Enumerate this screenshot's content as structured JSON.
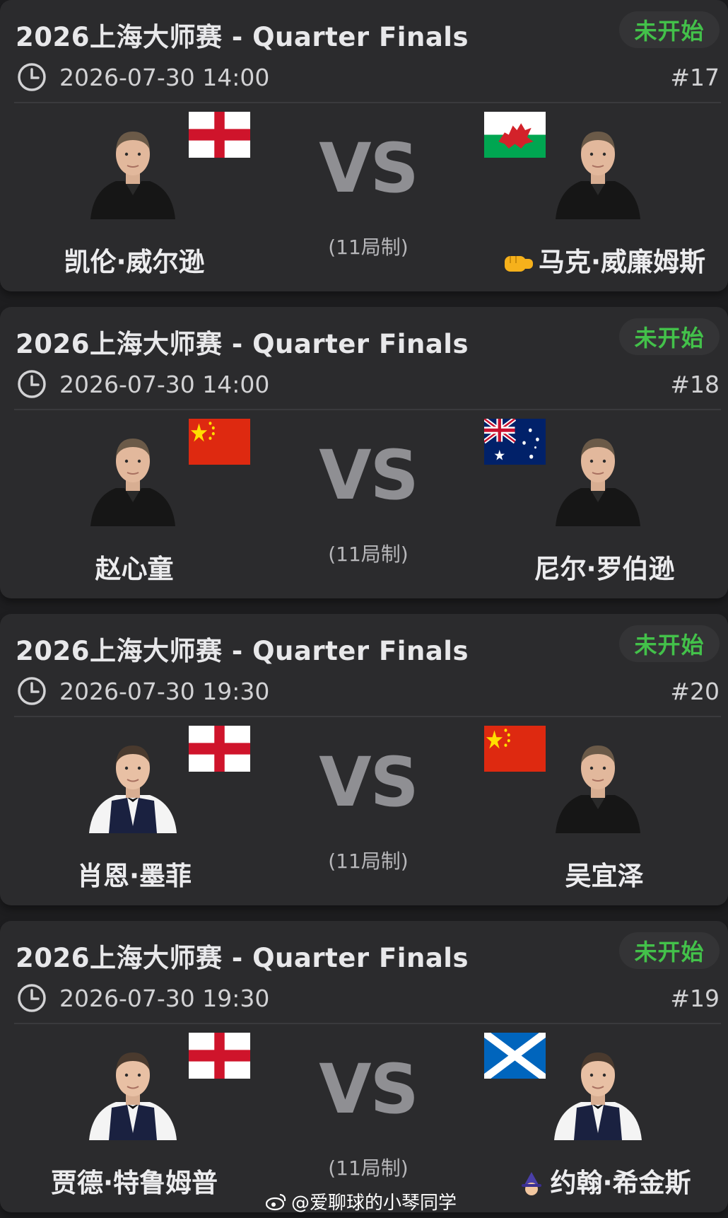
{
  "matches": [
    {
      "title": "2026上海大师赛 - Quarter Finals",
      "status": "未开始",
      "datetime": "2026-07-30 14:00",
      "match_no": "#17",
      "format": "(11局制)",
      "vs": "VS",
      "left_player": {
        "name": "凯伦·威尔逊",
        "flag": "england-flag"
      },
      "right_player": {
        "name": "马克·威廉姆斯",
        "flag": "wales-flag",
        "prefix_icon": "fist-emoji-icon"
      }
    },
    {
      "title": "2026上海大师赛 - Quarter Finals",
      "status": "未开始",
      "datetime": "2026-07-30 14:00",
      "match_no": "#18",
      "format": "(11局制)",
      "vs": "VS",
      "left_player": {
        "name": "赵心童",
        "flag": "china-flag"
      },
      "right_player": {
        "name": "尼尔·罗伯逊",
        "flag": "australia-flag"
      }
    },
    {
      "title": "2026上海大师赛 - Quarter Finals",
      "status": "未开始",
      "datetime": "2026-07-30 19:30",
      "match_no": "#20",
      "format": "(11局制)",
      "vs": "VS",
      "left_player": {
        "name": "肖恩·墨菲",
        "flag": "england-flag"
      },
      "right_player": {
        "name": "吴宜泽",
        "flag": "china-flag"
      }
    },
    {
      "title": "2026上海大师赛 - Quarter Finals",
      "status": "未开始",
      "datetime": "2026-07-30 19:30",
      "match_no": "#19",
      "format": "(11局制)",
      "vs": "VS",
      "left_player": {
        "name": "贾德·特鲁姆普",
        "flag": "england-flag"
      },
      "right_player": {
        "name": "约翰·希金斯",
        "flag": "scotland-flag",
        "prefix_icon": "wizard-emoji-icon"
      }
    }
  ],
  "watermark": "@爱聊球的小琴同学",
  "colors": {
    "status_green": "#43c14a",
    "card_bg": "#2b2b2d",
    "page_bg": "#1d1d1f"
  }
}
